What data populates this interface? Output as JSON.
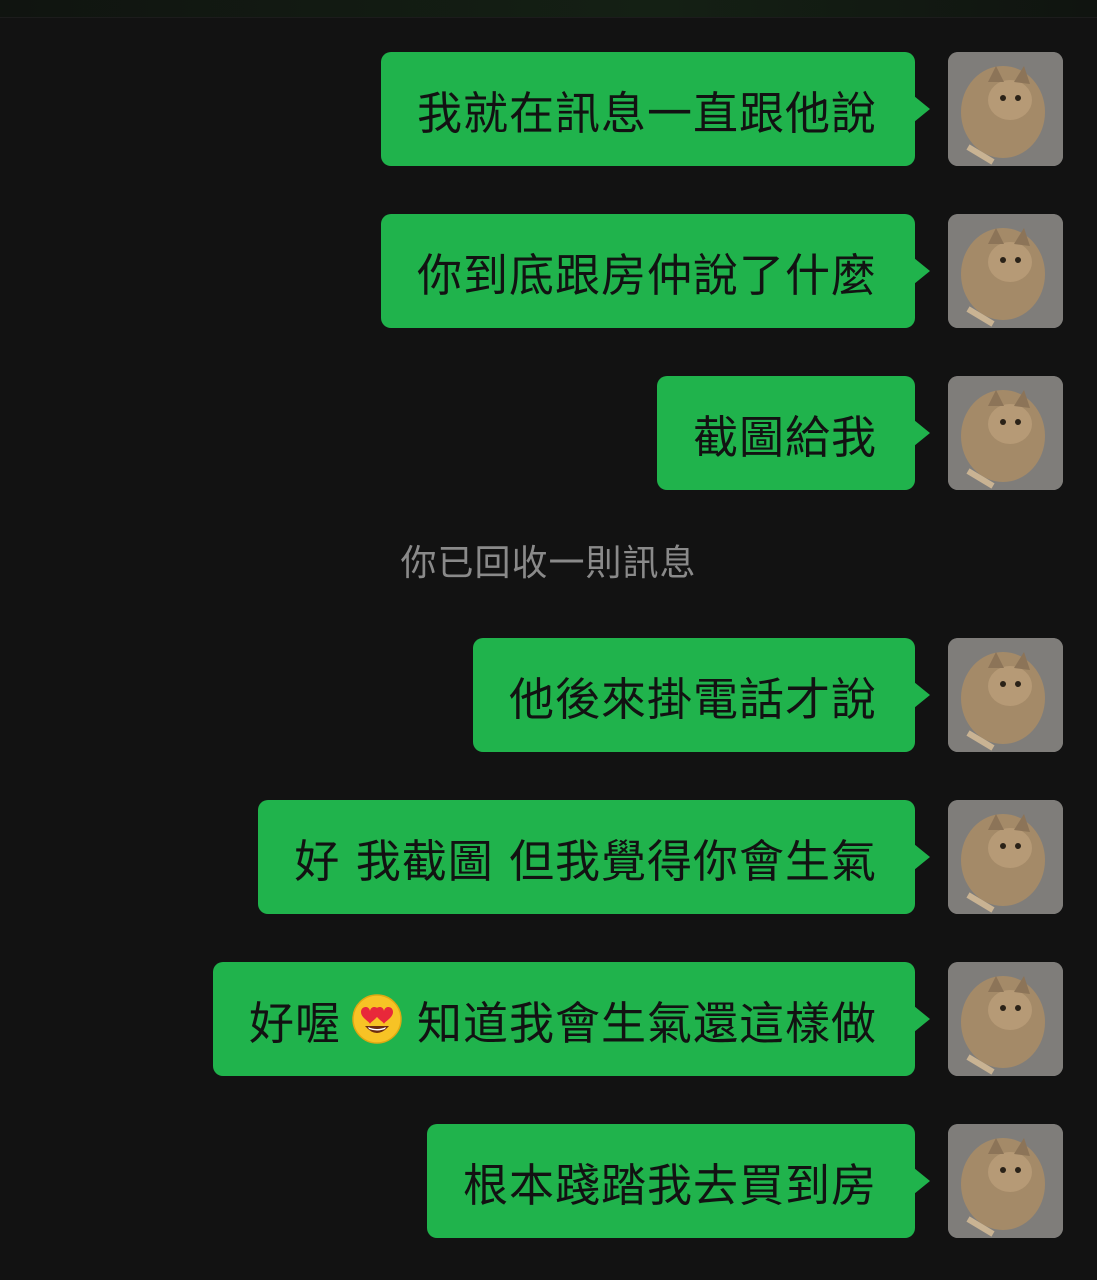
{
  "conversation": {
    "messages": [
      {
        "text": "我就在訊息一直跟他說"
      },
      {
        "text": "你到底跟房仲說了什麼"
      },
      {
        "text": "截圖給我"
      },
      {
        "text": "他後來掛電話才說"
      },
      {
        "text": "好 我截圖 但我覺得你會生氣"
      },
      {
        "text_before": "好喔",
        "emoji": "heart-eyes-emoji",
        "text_after": "知道我會生氣還這樣做"
      },
      {
        "text": "根本踐踏我去買到房"
      }
    ],
    "system_note": "你已回收一則訊息"
  },
  "colors": {
    "background": "#121212",
    "bubble": "#20b34c",
    "bubble_text": "#121212",
    "system_text": "#8a8a8a"
  }
}
